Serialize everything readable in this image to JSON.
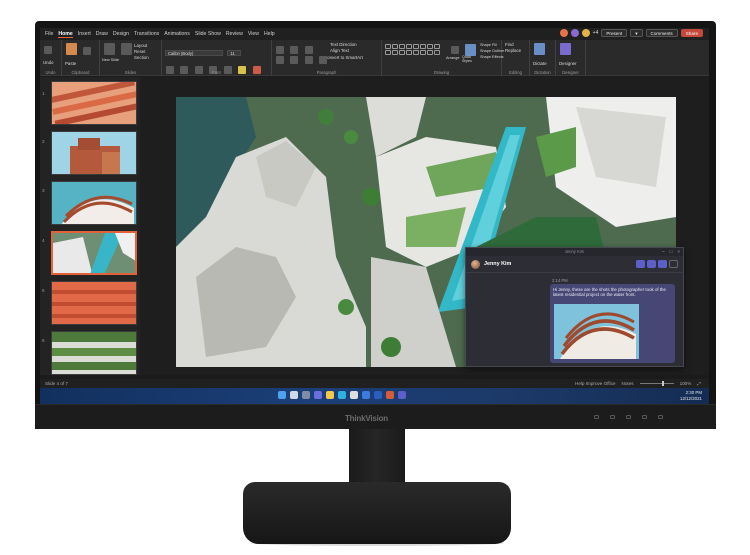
{
  "app": {
    "tabs": [
      "File",
      "Home",
      "Insert",
      "Draw",
      "Design",
      "Transitions",
      "Animations",
      "Slide Show",
      "Review",
      "View",
      "Help"
    ],
    "active_tab": "Home",
    "presenter_count": "+4",
    "present_label": "Present",
    "comments_label": "Comments",
    "share_label": "Share"
  },
  "ribbon": {
    "undo_label": "Undo",
    "paste_label": "Paste",
    "new_slide_label": "New Slide",
    "reuse_slides_label": "Reuse Slides",
    "layout_label": "Layout",
    "reset_label": "Reset",
    "section_label": "Section",
    "font_name": "Calibri (Body)",
    "font_size": "11",
    "text_direction_label": "Text Direction",
    "align_text_label": "Align Text",
    "convert_smartart_label": "Convert to SmartArt",
    "arrange_label": "Arrange",
    "quick_styles_label": "Quick Styles",
    "shape_fill_label": "Shape Fill",
    "shape_outline_label": "Shape Outline",
    "shape_effects_label": "Shape Effects",
    "find_label": "Find",
    "replace_label": "Replace",
    "dictate_label": "Dictate",
    "designer_label": "Designer",
    "groups": {
      "undo": "Undo",
      "clipboard": "Clipboard",
      "slides": "Slides",
      "font": "Font",
      "paragraph": "Paragraph",
      "drawing": "Drawing",
      "style": "Style",
      "editing": "Editing",
      "dictation": "Dictation",
      "designer": "Designer"
    }
  },
  "slides": {
    "numbers": [
      "1",
      "2",
      "3",
      "4",
      "5",
      "6"
    ],
    "selected_index": 4
  },
  "status": {
    "slide_info": "Slide 4 of 7",
    "help_improve": "Help Improve Office",
    "notes": "Notes",
    "zoom": "100%"
  },
  "taskbar": {
    "time": "2:30 PM",
    "date": "12/12/2021"
  },
  "chat": {
    "window_title": "Jenny Kim",
    "contact_name": "Jenny Kim",
    "message_time": "2:14 PM",
    "message_text": "Hi Jenny, these are the shots the photographer took of the latest residential project on the water front."
  },
  "monitor": {
    "brand": "ThinkVision"
  },
  "colors": {
    "accent": "#e0633c",
    "teams_purple": "#5b5fc7",
    "taskbar_blue": "#1b3f78",
    "pool_turquoise": "#33b8c8"
  }
}
